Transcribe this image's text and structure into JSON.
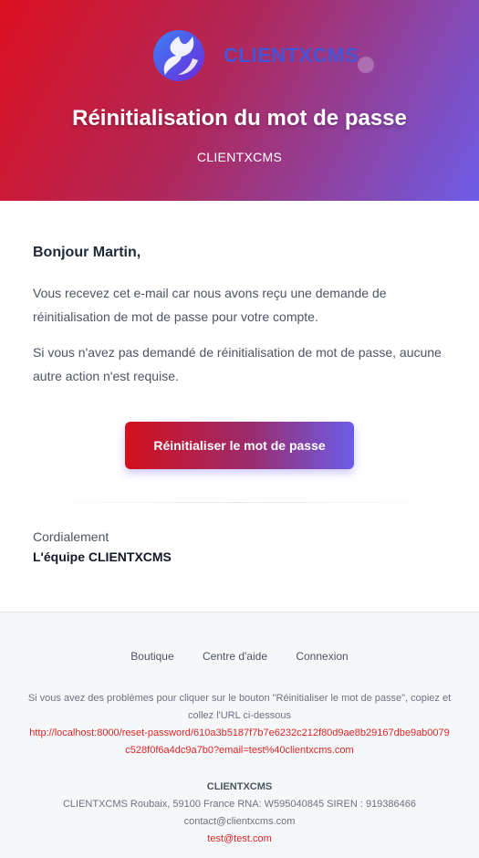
{
  "header": {
    "logo_text": "CLIENTXCMS",
    "title": "Réinitialisation du mot de passe",
    "subtitle": "CLIENTXCMS"
  },
  "body": {
    "greeting": "Bonjour Martin,",
    "paragraph1": "Vous recevez cet e-mail car nous avons reçu une demande de réinitialisation de mot de passe pour votre compte.",
    "paragraph2": "Si vous n'avez pas demandé de réinitialisation de mot de passe, aucune autre action n'est requise.",
    "button_label": "Réinitialiser le mot de passe",
    "regards": "Cordialement",
    "team": "L'équipe CLIENTXCMS"
  },
  "footer": {
    "links": [
      "Boutique",
      "Centre d'aide",
      "Connexion"
    ],
    "help_text": "Si vous avez des problèmes pour cliquer sur le bouton \"Réinitialiser le mot de passe\", copiez et collez l'URL ci-dessous",
    "reset_url": "http://localhost:8000/reset-password/610a3b5187f7b7e6232c212f80d9ae8b29167dbe9ab0079c528f0f6a4dc9a7b0?email=test%40clientxcms.com",
    "company_name": "CLIENTXCMS",
    "company_address": "CLIENTXCMS Roubaix, 59100 France RNA: W595040845 SIREN : 919386466",
    "company_email": "contact@clientxcms.com",
    "test_email": "test@test.com"
  },
  "colors": {
    "gradient_start": "#dc1020",
    "gradient_end": "#6c5ce7",
    "link_red": "#dc2626"
  }
}
